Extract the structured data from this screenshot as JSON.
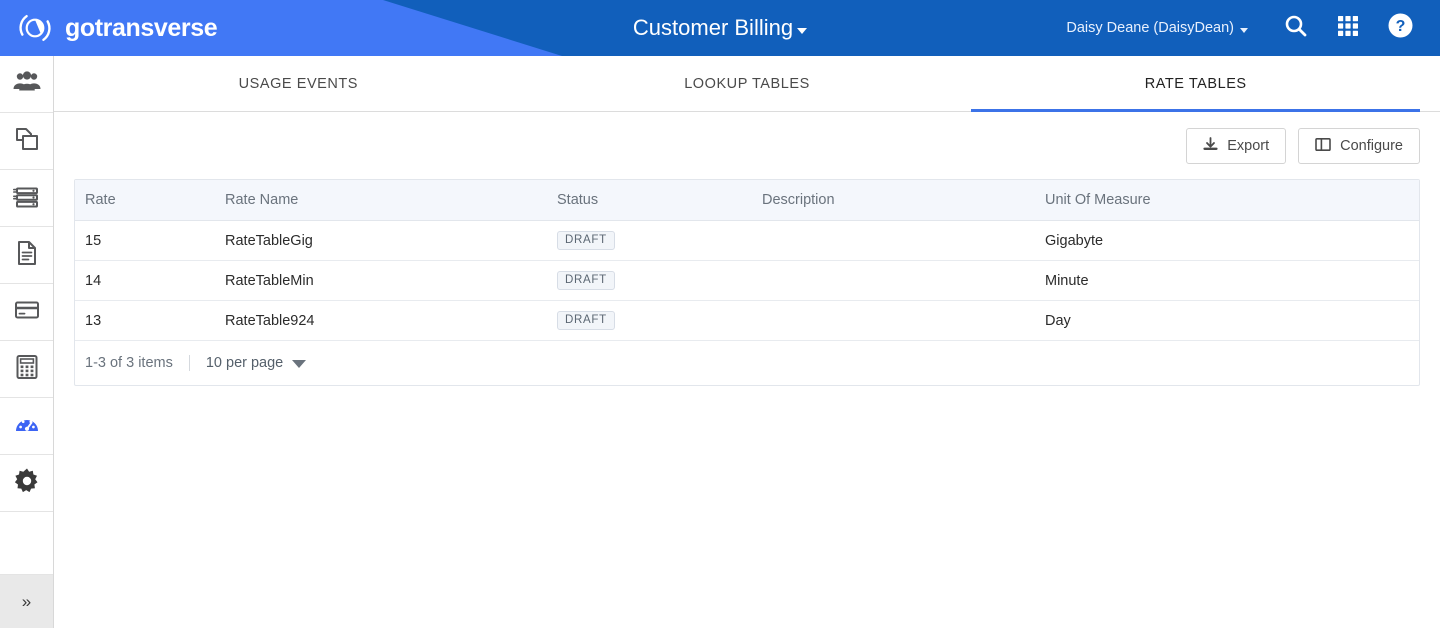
{
  "header": {
    "brand_name": "gotransverse",
    "brand_logo_icon": "gotransverse-circle-logo",
    "title": "Customer Billing",
    "title_caret_icon": "caret-down-icon",
    "user_name": "Daisy Deane (DaisyDean)",
    "user_caret_icon": "caret-down-icon",
    "icons": {
      "search": "search-icon",
      "apps": "apps-grid-icon",
      "help": "help-circle-icon"
    },
    "colors": {
      "bg_dark": "#115fbb",
      "bg_light": "#4178f5",
      "text": "#ffffff"
    }
  },
  "sidebar": {
    "items": [
      {
        "icon": "users-group-icon",
        "active": false
      },
      {
        "icon": "copy-pages-icon",
        "active": false
      },
      {
        "icon": "server-stack-icon",
        "active": false
      },
      {
        "icon": "document-icon",
        "active": false
      },
      {
        "icon": "credit-card-icon",
        "active": false
      },
      {
        "icon": "calculator-icon",
        "active": false
      },
      {
        "icon": "speedometer-icon",
        "active": true
      },
      {
        "icon": "gear-icon",
        "active": false
      }
    ],
    "toggle": {
      "icon": "double-chevron-right-icon",
      "glyph": "»"
    },
    "active_color": "#3c64f4",
    "inactive_color": "#57585a"
  },
  "tabs": [
    {
      "label": "USAGE EVENTS",
      "active": false
    },
    {
      "label": "LOOKUP TABLES",
      "active": false
    },
    {
      "label": "RATE TABLES",
      "active": true
    }
  ],
  "toolbar": {
    "export_label": "Export",
    "export_icon": "download-icon",
    "configure_label": "Configure",
    "configure_icon": "columns-layout-icon"
  },
  "table": {
    "columns": [
      "Rate",
      "Rate Name",
      "Status",
      "Description",
      "Unit Of Measure"
    ],
    "rows": [
      {
        "rate": "15",
        "name": "RateTableGig",
        "status": "DRAFT",
        "description": "",
        "uom": "Gigabyte"
      },
      {
        "rate": "14",
        "name": "RateTableMin",
        "status": "DRAFT",
        "description": "",
        "uom": "Minute"
      },
      {
        "rate": "13",
        "name": "RateTable924",
        "status": "DRAFT",
        "description": "",
        "uom": "Day"
      }
    ],
    "footer": {
      "count_text": "1-3 of 3 items",
      "per_page_text": "10 per page",
      "per_page_caret_icon": "chevron-down-icon"
    }
  },
  "accent_color": "#3c73e8"
}
